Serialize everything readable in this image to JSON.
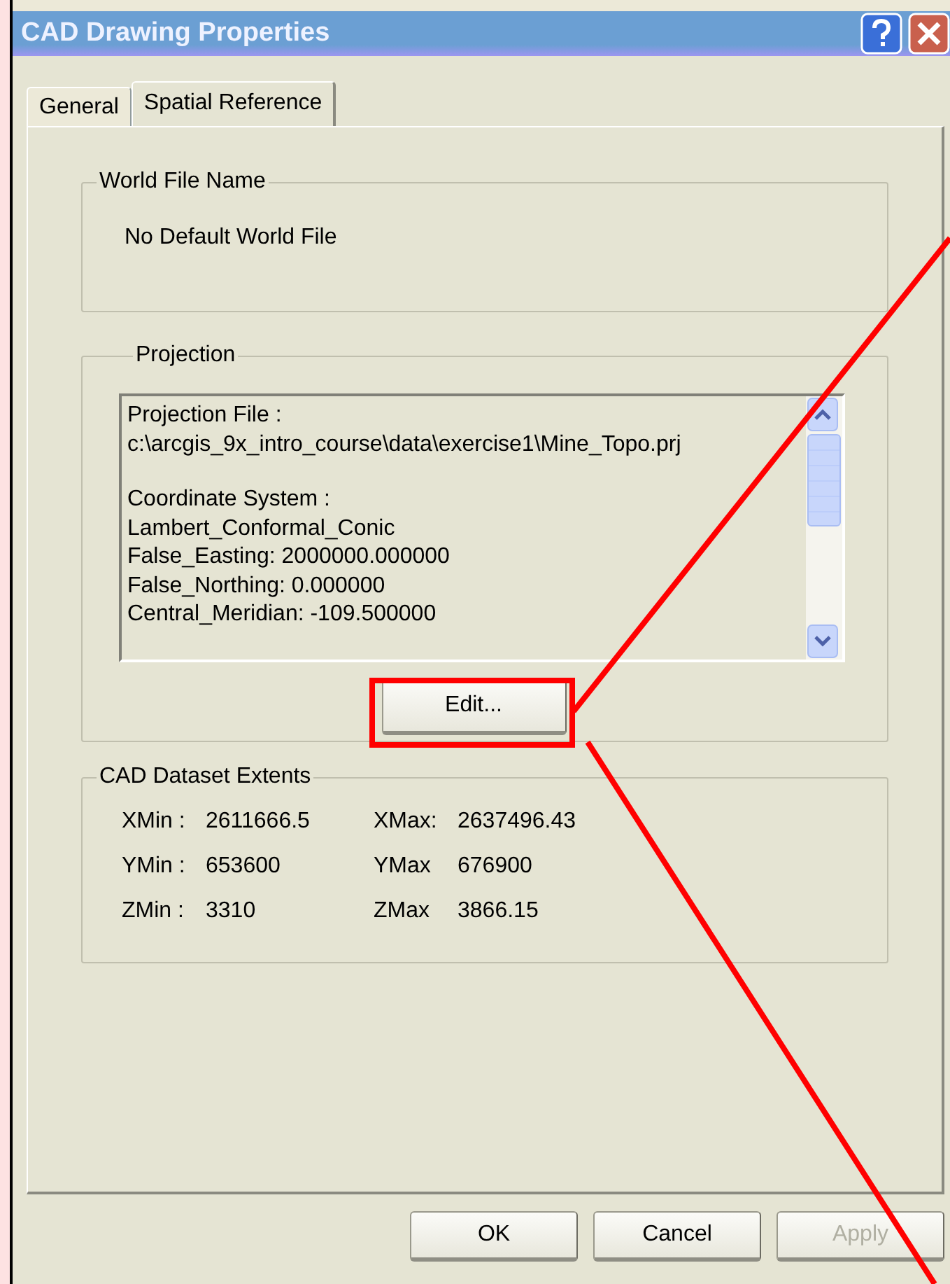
{
  "window": {
    "title": "CAD Drawing Properties"
  },
  "tabs": [
    {
      "label": "General",
      "selected": false
    },
    {
      "label": "Spatial Reference",
      "selected": true
    }
  ],
  "world_file": {
    "title": "World File Name",
    "value": "No Default World File"
  },
  "projection": {
    "title": "Projection",
    "paragraphs": [
      [
        "Projection File :",
        "c:\\arcgis_9x_intro_course\\data\\exercise1\\Mine_Topo.prj"
      ],
      [
        "Coordinate System :",
        "Lambert_Conformal_Conic",
        "False_Easting: 2000000.000000",
        "False_Northing: 0.000000",
        "Central_Meridian: -109.500000"
      ]
    ],
    "edit_button": "Edit..."
  },
  "extents": {
    "title": "CAD Dataset Extents",
    "rows": [
      {
        "min_label": "XMin :",
        "min_value": "2611666.5",
        "max_label": "XMax:",
        "max_value": "2637496.43"
      },
      {
        "min_label": "YMin :",
        "min_value": "653600",
        "max_label": "YMax",
        "max_value": "676900"
      },
      {
        "min_label": "ZMin :",
        "min_value": "3310",
        "max_label": "ZMax",
        "max_value": "3866.15"
      }
    ]
  },
  "buttons": [
    {
      "label": "OK",
      "disabled": false
    },
    {
      "label": "Cancel",
      "disabled": false
    },
    {
      "label": "Apply",
      "disabled": true
    }
  ]
}
